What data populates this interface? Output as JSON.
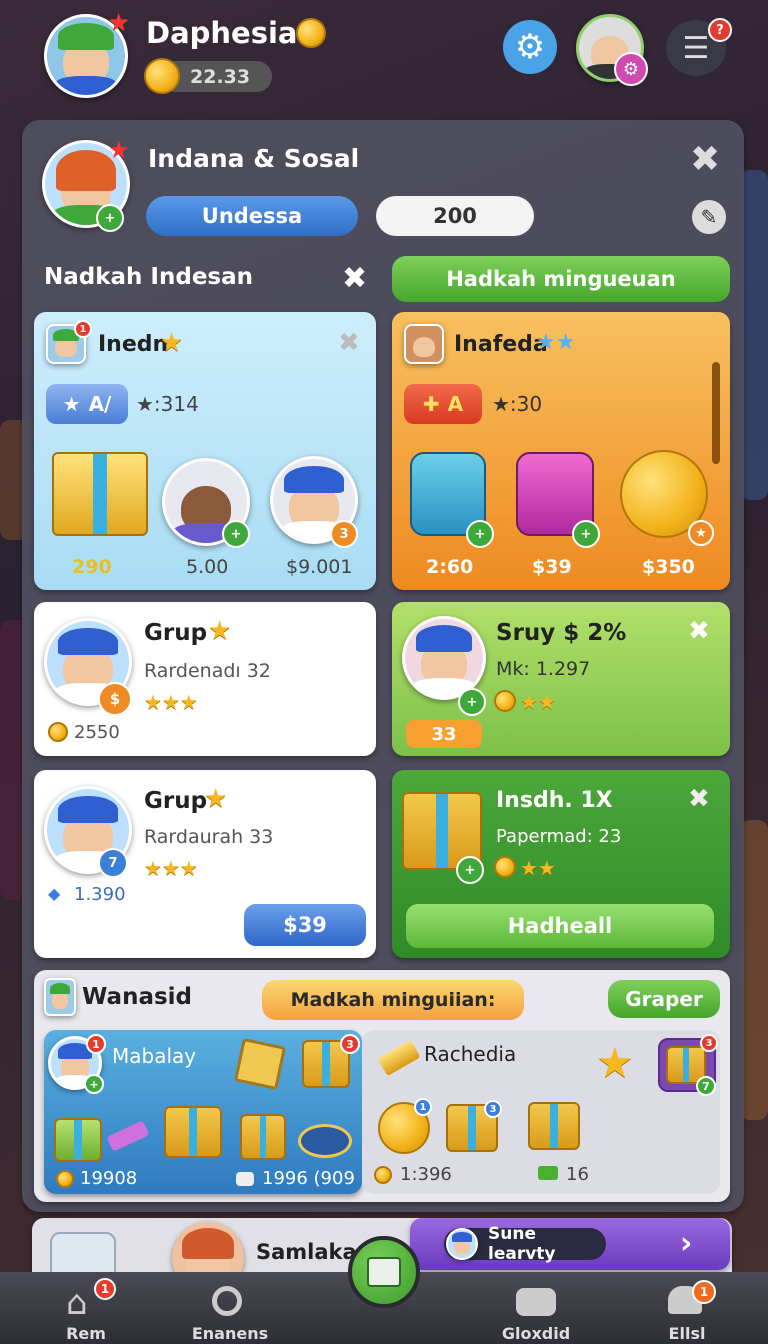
{
  "header": {
    "player_name": "Daphesian",
    "coins": "22.33"
  },
  "panel": {
    "title": "Indana & Sosal",
    "tab_active": "Undessa",
    "tab_value": "200"
  },
  "section": {
    "left_title": "Nadkah Indesan",
    "right_button": "Hadkah mingueuan"
  },
  "card_blue": {
    "name": "Inedn",
    "tag": "A/",
    "score": "★:314",
    "values": [
      "290",
      "5.00",
      "$9.001"
    ]
  },
  "card_orange": {
    "name": "Inafeda",
    "tag": "A",
    "score": "★:30",
    "values": [
      "2:60",
      "$39",
      "$350"
    ]
  },
  "card_grup1": {
    "name": "Grup",
    "desc": "Rardenadı 32",
    "coins": "2550"
  },
  "card_green1": {
    "name": "Sruy $ 2%",
    "desc": "Mk: 1.297",
    "value": "33"
  },
  "card_grup2": {
    "name": "Grup",
    "desc": "Rardaurah 33",
    "coins": "1.390",
    "price": "$39"
  },
  "card_green2": {
    "name": "Insdh. 1X",
    "desc": "Papermad: 23",
    "button": "Hadheall"
  },
  "bottom_panel": {
    "title": "Wanasid",
    "banner": "Madkah minguiian:",
    "button": "Graper",
    "left": {
      "label": "Mabalay",
      "val1": "19908",
      "val2": "1996 (909"
    },
    "right": {
      "label": "Rachedia",
      "val1": "1:396",
      "val2": "16"
    }
  },
  "footer_strip": {
    "label": "Samlaka",
    "promo": "Sune learvty"
  },
  "tabbar": {
    "items": [
      "Rem",
      "Enanens",
      "",
      "Gloxdid",
      "Ellsl"
    ]
  },
  "colors": {
    "accent_green": "#5cb83a",
    "accent_blue": "#3b7fd8",
    "gold": "#f3b21a"
  }
}
